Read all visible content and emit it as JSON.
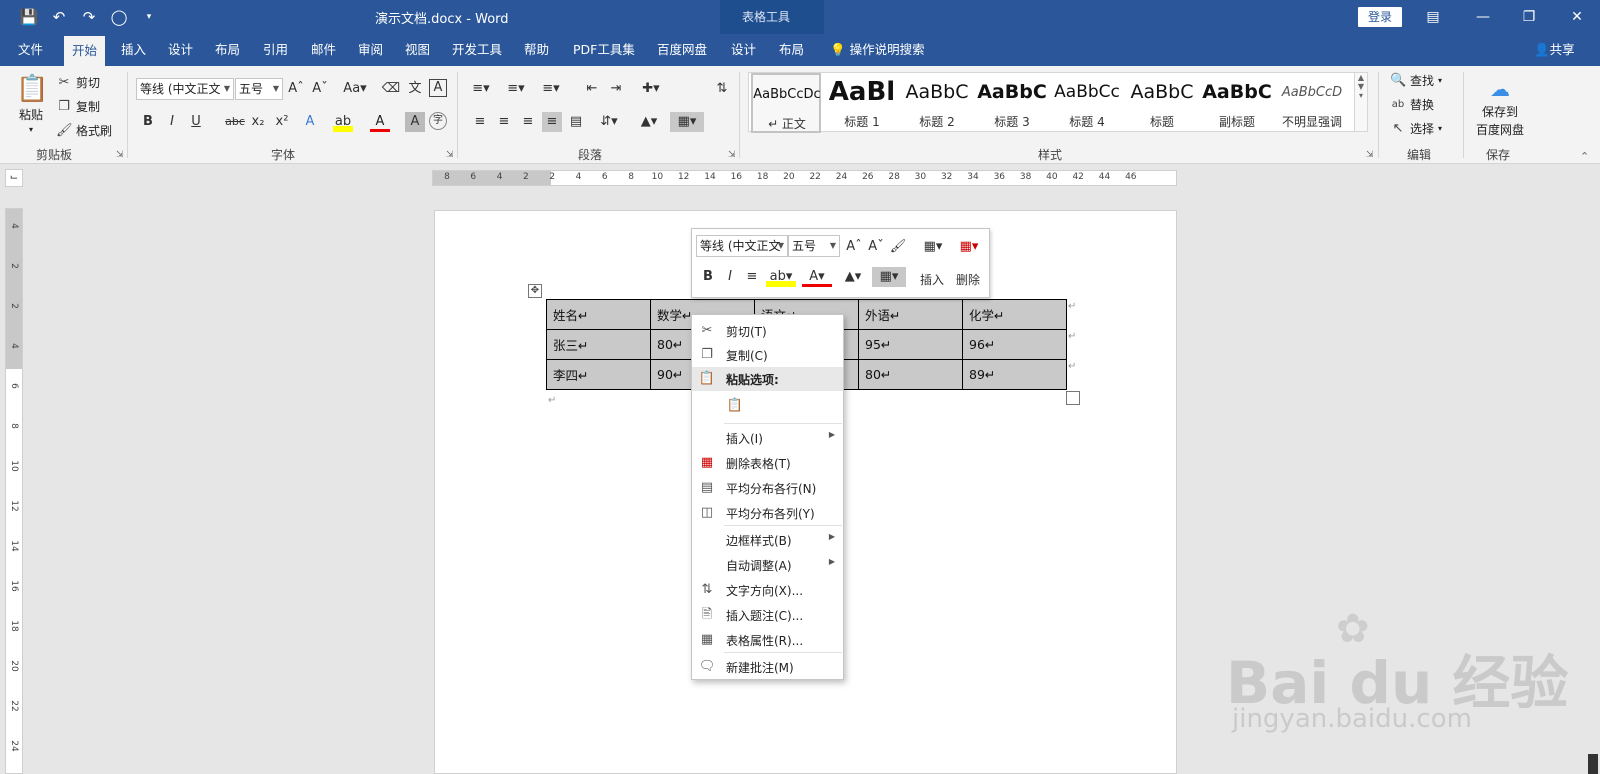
{
  "window": {
    "doc_title": "演示文档.docx  -  Word",
    "context_tool": "表格工具",
    "login": "登录"
  },
  "tabs": [
    "文件",
    "开始",
    "插入",
    "设计",
    "布局",
    "引用",
    "邮件",
    "审阅",
    "视图",
    "开发工具",
    "帮助",
    "PDF工具集",
    "百度网盘",
    "设计",
    "布局"
  ],
  "active_tab": "开始",
  "tell_me": "操作说明搜索",
  "share": "共享",
  "ribbon": {
    "clipboard": {
      "label": "剪贴板",
      "paste": "粘贴",
      "cut": "剪切",
      "copy": "复制",
      "format_painter": "格式刷"
    },
    "font": {
      "label": "字体",
      "font_name": "等线 (中文正文",
      "font_size": "五号"
    },
    "paragraph": {
      "label": "段落"
    },
    "styles": {
      "label": "样式",
      "items": [
        {
          "sample": "AaBbCcDc",
          "name": "↵ 正文"
        },
        {
          "sample": "AaBl",
          "name": "标题 1"
        },
        {
          "sample": "AaBbC",
          "name": "标题 2"
        },
        {
          "sample": "AaBbC",
          "name": "标题 3"
        },
        {
          "sample": "AaBbCc",
          "name": "标题 4"
        },
        {
          "sample": "AaBbC",
          "name": "标题"
        },
        {
          "sample": "AaBbC",
          "name": "副标题"
        },
        {
          "sample": "AaBbCcD",
          "name": "不明显强调"
        }
      ]
    },
    "editing": {
      "label": "编辑",
      "find": "查找",
      "replace": "替换",
      "select": "选择"
    },
    "save": {
      "label": "保存",
      "button_line1": "保存到",
      "button_line2": "百度网盘"
    }
  },
  "ruler": {
    "h_ticks": [
      "8",
      "6",
      "4",
      "2",
      "2",
      "4",
      "6",
      "8",
      "10",
      "12",
      "14",
      "16",
      "18",
      "20",
      "22",
      "24",
      "26",
      "28",
      "30",
      "32",
      "34",
      "36",
      "38",
      "40",
      "42",
      "44",
      "46"
    ],
    "v_ticks": [
      "4",
      "2",
      "2",
      "4",
      "6",
      "8",
      "10",
      "12",
      "14",
      "16",
      "18",
      "20",
      "22",
      "24"
    ]
  },
  "table": {
    "rows": [
      [
        "姓名↵",
        "数学↵",
        "语文↵",
        "外语↵",
        "化学↵"
      ],
      [
        "张三↵",
        "80↵",
        "",
        "95↵",
        "96↵"
      ],
      [
        "李四↵",
        "90↵",
        "",
        "80↵",
        "89↵"
      ]
    ]
  },
  "mini_toolbar": {
    "font_name": "等线 (中文正文",
    "font_size": "五号",
    "insert": "插入",
    "delete": "删除"
  },
  "context_menu": [
    {
      "label": "剪切(T)",
      "icon": "scissors-icon",
      "sub": false
    },
    {
      "label": "复制(C)",
      "icon": "copy-icon",
      "sub": false
    },
    {
      "label": "粘贴选项:",
      "icon": "paste-icon",
      "sub": false,
      "highlight": true
    },
    {
      "label": "",
      "icon": "paste-text-only-icon",
      "sub": false
    },
    {
      "label": "插入(I)",
      "icon": "",
      "sub": true
    },
    {
      "label": "删除表格(T)",
      "icon": "delete-table-icon",
      "sub": false
    },
    {
      "label": "平均分布各行(N)",
      "icon": "distribute-rows-icon",
      "sub": false
    },
    {
      "label": "平均分布各列(Y)",
      "icon": "distribute-columns-icon",
      "sub": false
    },
    {
      "label": "边框样式(B)",
      "icon": "",
      "sub": true
    },
    {
      "label": "自动调整(A)",
      "icon": "",
      "sub": true
    },
    {
      "label": "文字方向(X)...",
      "icon": "text-direction-icon",
      "sub": false
    },
    {
      "label": "插入题注(C)...",
      "icon": "caption-icon",
      "sub": false
    },
    {
      "label": "表格属性(R)...",
      "icon": "table-properties-icon",
      "sub": false
    },
    {
      "label": "新建批注(M)",
      "icon": "comment-icon",
      "sub": false
    }
  ],
  "watermark": {
    "brand": "Bai du 经验",
    "url": "jingyan.baidu.com"
  },
  "colors": {
    "brand": "#2b579a",
    "ribbon_bg": "#f3f3f3",
    "table_fill": "#c9c9c9"
  }
}
